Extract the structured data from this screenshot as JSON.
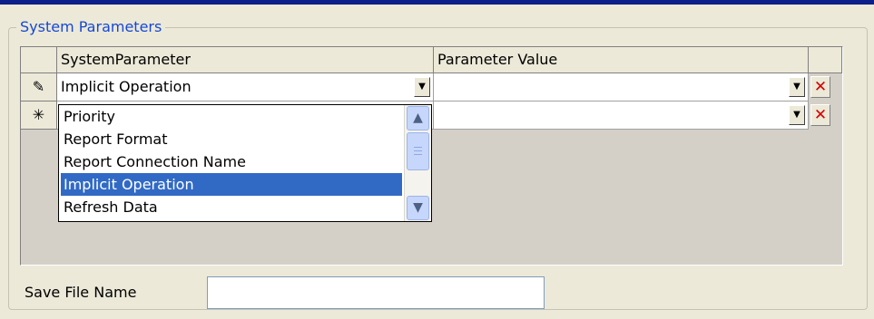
{
  "group": {
    "title": "System Parameters"
  },
  "grid": {
    "columns": [
      "SystemParameter",
      "Parameter Value"
    ],
    "rows": [
      {
        "selector_icon": "pencil-icon",
        "selector_glyph": "✎",
        "parameter": "Implicit Operation",
        "value": "",
        "delete_glyph": "✕"
      },
      {
        "selector_icon": "asterisk-icon",
        "selector_glyph": "✳",
        "parameter": "",
        "value": "",
        "delete_glyph": "✕"
      }
    ],
    "dropdown_glyph": "▼"
  },
  "dropdown": {
    "options": [
      "Priority",
      "Report Format",
      "Report Connection Name",
      "Implicit Operation",
      "Refresh Data"
    ],
    "selected_index": 3,
    "scroll_up_glyph": "▲",
    "scroll_down_glyph": "▼"
  },
  "save": {
    "label": "Save File Name",
    "value": ""
  },
  "colors": {
    "title_blue": "#1648d6",
    "selection_blue": "#316ac5",
    "delete_red": "#d40000",
    "top_bar": "#0b1f8a"
  }
}
